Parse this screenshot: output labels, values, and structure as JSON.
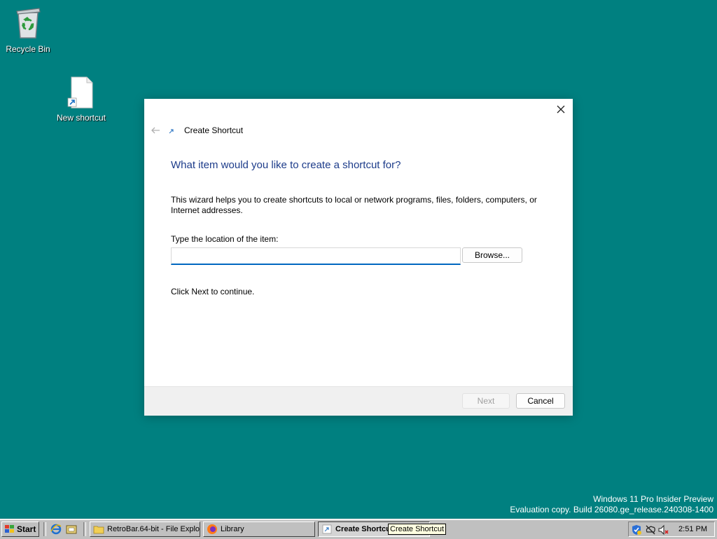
{
  "desktop": {
    "icons": [
      {
        "label": "Recycle Bin",
        "icon": "recycle-bin-icon"
      },
      {
        "label": "New shortcut",
        "icon": "blank-file-shortcut-icon"
      }
    ],
    "watermark": {
      "line1": "Windows 11 Pro Insider Preview",
      "line2": "Evaluation copy. Build 26080.ge_release.240308-1400"
    },
    "background_color": "#008080"
  },
  "dialog": {
    "title": "Create Shortcut",
    "heading": "What item would you like to create a shortcut for?",
    "description": "This wizard helps you to create shortcuts to local or network programs, files, folders, computers, or Internet addresses.",
    "location_label": "Type the location of the item:",
    "location_value": "",
    "browse_label": "Browse...",
    "hint": "Click Next to continue.",
    "next_label": "Next",
    "cancel_label": "Cancel",
    "accent_color": "#0067c0",
    "heading_color": "#1d3c8a"
  },
  "taskbar": {
    "start_label": "Start",
    "quick_launch": [
      "internet-explorer-icon",
      "show-desktop-icon"
    ],
    "tasks": [
      {
        "label": "RetroBar.64-bit - File Explo...",
        "icon": "folder-icon",
        "active": false
      },
      {
        "label": "Library",
        "icon": "firefox-icon",
        "active": false
      },
      {
        "label": "Create Shortcut",
        "icon": "shortcut-icon",
        "active": true
      }
    ],
    "tray_icons": [
      "defender-shield-icon",
      "network-offline-icon",
      "volume-muted-icon"
    ],
    "clock": "2:51 PM",
    "tooltip": "Create Shortcut"
  }
}
